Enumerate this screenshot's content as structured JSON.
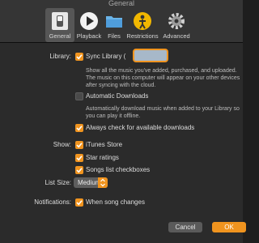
{
  "window": {
    "title": "General"
  },
  "toolbar": {
    "items": [
      {
        "label": "General",
        "icon": "general-switch-icon",
        "selected": true
      },
      {
        "label": "Playback",
        "icon": "play-icon",
        "selected": false
      },
      {
        "label": "Files",
        "icon": "folder-icon",
        "selected": false
      },
      {
        "label": "Restrictions",
        "icon": "restrictions-icon",
        "selected": false
      },
      {
        "label": "Advanced",
        "icon": "gear-icon",
        "selected": false
      }
    ]
  },
  "library": {
    "section_label": "Library:",
    "sync_library_label": "Sync Library (",
    "sync_library_checked": true,
    "sync_description": "Show all the music you've added, purchased, and uploaded. The music on this computer will appear on your other devices after syncing with the cloud.",
    "auto_downloads_label": "Automatic Downloads",
    "auto_downloads_checked": false,
    "auto_downloads_description": "Automatically download music when added to your Library so you can play it offline.",
    "always_check_label": "Always check for available downloads",
    "always_check_checked": true
  },
  "show": {
    "section_label": "Show:",
    "itunes_store_label": "iTunes Store",
    "itunes_store_checked": true,
    "star_ratings_label": "Star ratings",
    "star_ratings_checked": true,
    "songs_checkboxes_label": "Songs list checkboxes",
    "songs_checkboxes_checked": true
  },
  "list_size": {
    "label": "List Size:",
    "value": "Medium"
  },
  "notifications": {
    "label": "Notifications:",
    "song_changes_label": "When song changes",
    "song_changes_checked": true
  },
  "buttons": {
    "cancel": "Cancel",
    "ok": "OK"
  },
  "colors": {
    "accent": "#f0941f",
    "background": "#2b2b2b",
    "toolbar": "#353535"
  }
}
